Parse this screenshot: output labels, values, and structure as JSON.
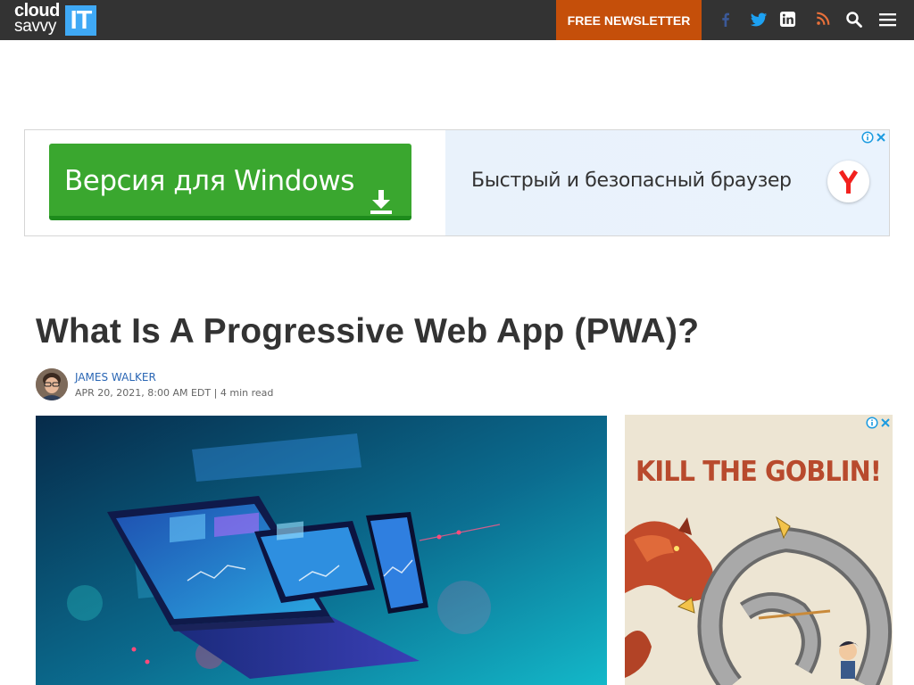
{
  "header": {
    "logo": {
      "line1": "cloud",
      "line2": "savvy",
      "box": "IT"
    },
    "newsletter_label": "FREE NEWSLETTER",
    "icons": [
      "facebook-icon",
      "twitter-icon",
      "linkedin-icon",
      "rss-icon",
      "search-icon",
      "menu-icon"
    ],
    "colors": {
      "bar": "#333333",
      "newsletter": "#c54f0a",
      "logo_box": "#3fa9f5"
    }
  },
  "top_ad": {
    "button_label": "Версия для Windows",
    "slogan": "Быстрый и безопасный браузер",
    "icons": [
      "download-icon",
      "yandex-logo-icon",
      "ad-info-icon",
      "ad-close-icon"
    ],
    "colors": {
      "button": "#3aa72f",
      "panel": "#e9f2fb"
    }
  },
  "article": {
    "title": "What Is A Progressive Web App (PWA)?",
    "author": "JAMES WALKER",
    "date": "APR 20, 2021, 8:00 AM EDT",
    "separator": "|",
    "read_time": "4 min read"
  },
  "side_ad": {
    "headline": "KILL THE GOBLIN!",
    "icons": [
      "ad-info-icon",
      "ad-close-icon"
    ],
    "colors": {
      "background": "#ede5d3",
      "headline": "#b84a2d"
    }
  }
}
